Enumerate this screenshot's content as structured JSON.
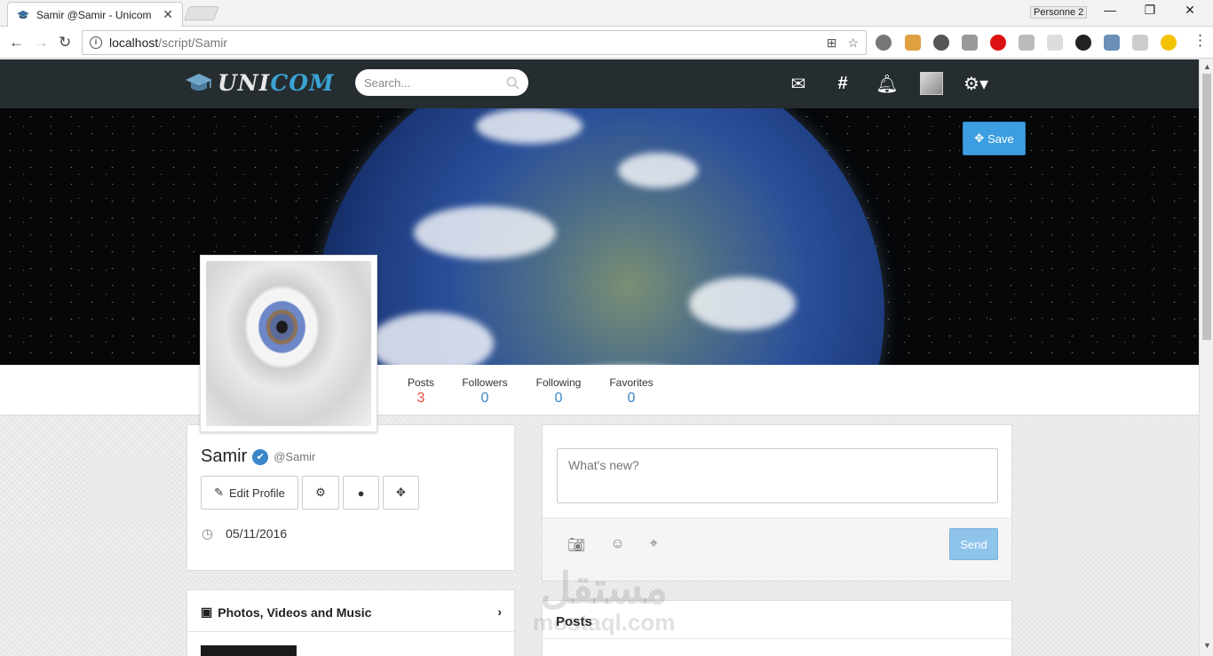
{
  "browser": {
    "tab_title": "Samir @Samir - Unicom",
    "tab_close": "✕",
    "profile_name": "Personne 2",
    "url_host": "localhost",
    "url_path": "/script/Samir",
    "win_min": "—",
    "win_restore": "❐",
    "win_close": "✕"
  },
  "site": {
    "logo_a": "UNI",
    "logo_b": "COM",
    "search_placeholder": "Search..."
  },
  "cover": {
    "save_label": "Save"
  },
  "stats": [
    {
      "label": "Posts",
      "value": "3"
    },
    {
      "label": "Followers",
      "value": "0"
    },
    {
      "label": "Following",
      "value": "0"
    },
    {
      "label": "Favorites",
      "value": "0"
    }
  ],
  "profile": {
    "name": "Samir",
    "handle": "@Samir",
    "edit_label": "Edit Profile",
    "joined_date": "05/11/2016"
  },
  "composer": {
    "placeholder": "What's new?",
    "send_label": "Send"
  },
  "media": {
    "title": "Photos, Videos and Music"
  },
  "posts": {
    "title": "Posts"
  },
  "watermark": {
    "arabic": "مستقل",
    "latin": "mostaql.com"
  },
  "colors": {
    "navbar": "#252d30",
    "accent": "#3c9ee0",
    "active_stat": "#e74c3c"
  }
}
